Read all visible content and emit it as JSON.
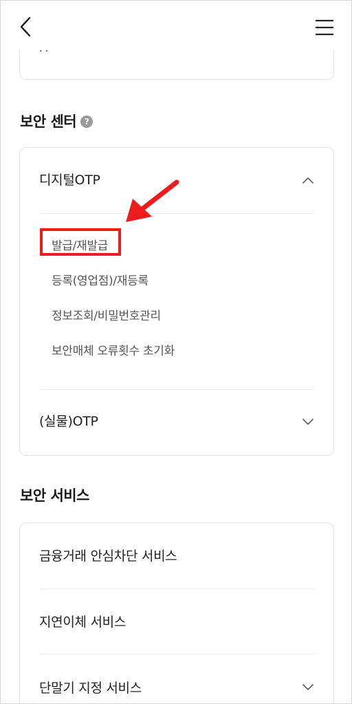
{
  "header": {
    "back_icon": "chevron-left-icon",
    "menu_icon": "hamburger-menu-icon"
  },
  "prev_card": {
    "partial_text": "· ·"
  },
  "security_center": {
    "title": "보안 센터",
    "help_glyph": "?",
    "digital_otp": {
      "label": "디지털OTP",
      "expanded": true,
      "items": [
        {
          "label": "발급/재발급",
          "highlighted": true
        },
        {
          "label": "등록(영업점)/재등록"
        },
        {
          "label": "정보조회/비밀번호관리"
        },
        {
          "label": "보안매체 오류횟수 초기화"
        }
      ]
    },
    "physical_otp": {
      "label": "(실물)OTP",
      "expanded": false
    }
  },
  "security_services": {
    "title": "보안 서비스",
    "items": [
      {
        "label": "금융거래 안심차단 서비스"
      },
      {
        "label": "지연이체 서비스"
      },
      {
        "label": "단말기 지정 서비스"
      }
    ]
  },
  "annotation": {
    "highlight_color": "#ee1c1c"
  }
}
